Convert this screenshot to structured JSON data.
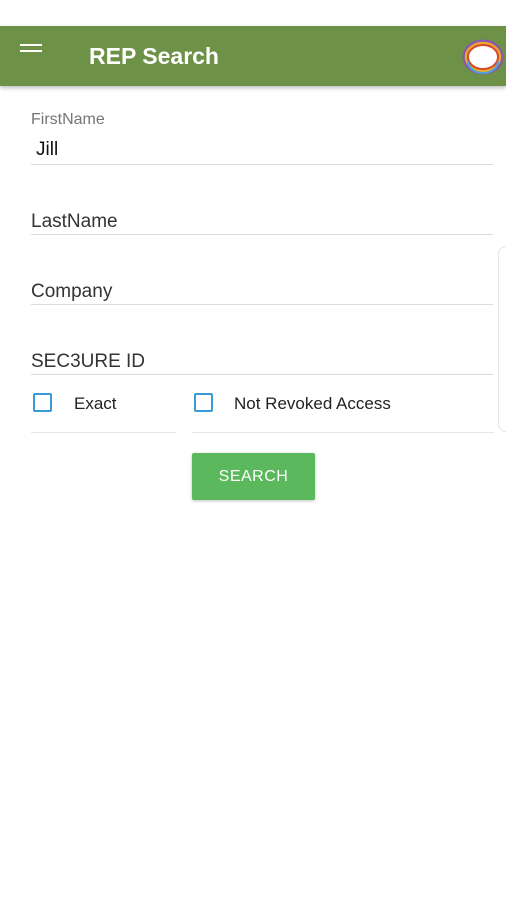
{
  "app_bar": {
    "title": "REP Search",
    "color": "#6e9148",
    "menu_icon": "hamburger-menu-icon",
    "logo_icon": "ring-logo-icon"
  },
  "form": {
    "first_name": {
      "label": "FirstName",
      "value": "Jill"
    },
    "last_name": {
      "placeholder": "LastName"
    },
    "company": {
      "placeholder": "Company"
    },
    "secure_id": {
      "placeholder": "SEC3URE ID"
    },
    "checkboxes": {
      "exact": {
        "label": "Exact",
        "checked": false
      },
      "not_revoked": {
        "label": "Not Revoked Access",
        "checked": false
      }
    }
  },
  "search_button": {
    "label": "SEARCH",
    "color": "#5cb85c"
  },
  "colors": {
    "checkbox_border": "#3a9ad9"
  }
}
